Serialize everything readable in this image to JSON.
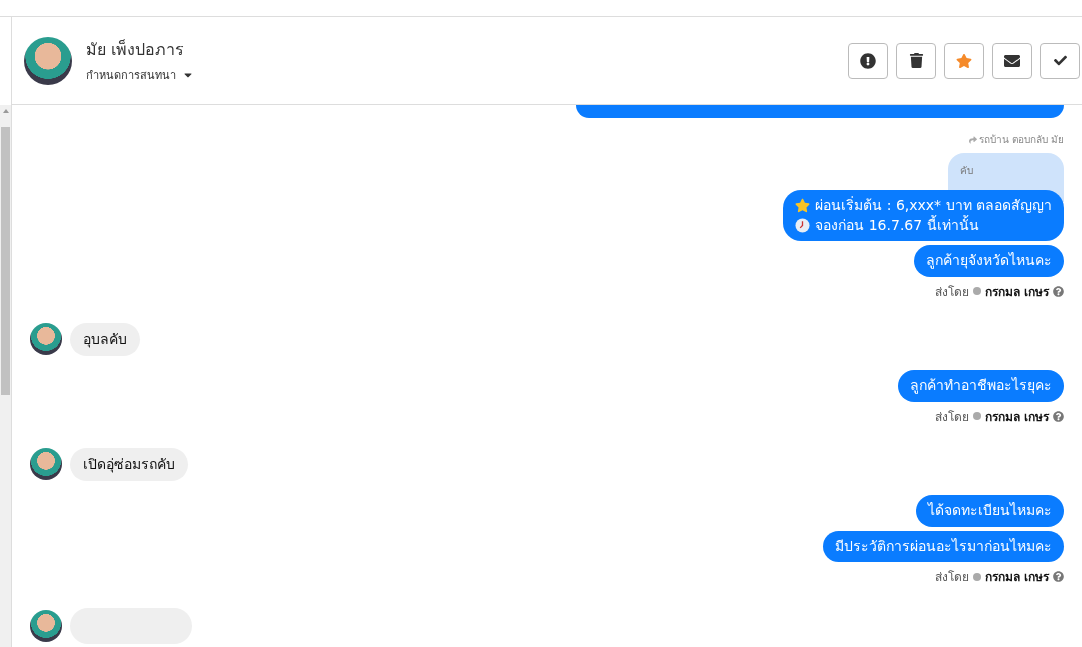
{
  "header": {
    "name": "มัย เพ็งปอภาร",
    "menu_label": "กำหนดการสนทนา",
    "actions": [
      {
        "kind": "alert"
      },
      {
        "kind": "trash"
      },
      {
        "kind": "star",
        "on": true
      },
      {
        "kind": "mail"
      },
      {
        "kind": "check"
      }
    ]
  },
  "messages": [
    {
      "kind": "cut_outgoing"
    },
    {
      "kind": "reply_note",
      "text": "รถบ้าน ตอบกลับ มัย"
    },
    {
      "kind": "quoted",
      "text": "คับ"
    },
    {
      "kind": "outgoing",
      "lines": [
        {
          "kind": "star",
          "text": "ผ่อนเริ่มต้น : 6,xxx* บาท ตลอดสัญญา"
        },
        {
          "kind": "clock",
          "text": "จองก่อน 16.7.67 นี้เท่านั้น"
        }
      ]
    },
    {
      "kind": "outgoing",
      "lines": [
        {
          "text": "ลูกค้ายุจังหวัดไหนคะ"
        }
      ]
    },
    {
      "kind": "sent_by",
      "label": "ส่งโดย",
      "sender": "กรกมล เกษร"
    },
    {
      "kind": "incoming",
      "text": "อุบลคับ"
    },
    {
      "kind": "outgoing",
      "lines": [
        {
          "text": "ลูกค้าทำอาชีพอะไรยุคะ"
        }
      ]
    },
    {
      "kind": "sent_by",
      "label": "ส่งโดย",
      "sender": "กรกมล เกษร"
    },
    {
      "kind": "incoming",
      "text": "เปิดอุ่ซ่อมรถคับ"
    },
    {
      "kind": "outgoing",
      "lines": [
        {
          "text": "ได้จดทะเบียนไหมคะ"
        }
      ]
    },
    {
      "kind": "outgoing",
      "lines": [
        {
          "text": "มีประวัติการผ่อนอะไรมาก่อนไหมคะ"
        }
      ]
    },
    {
      "kind": "sent_by",
      "label": "ส่งโดย",
      "sender": "กรกมล เกษร"
    },
    {
      "kind": "cut_incoming"
    }
  ]
}
